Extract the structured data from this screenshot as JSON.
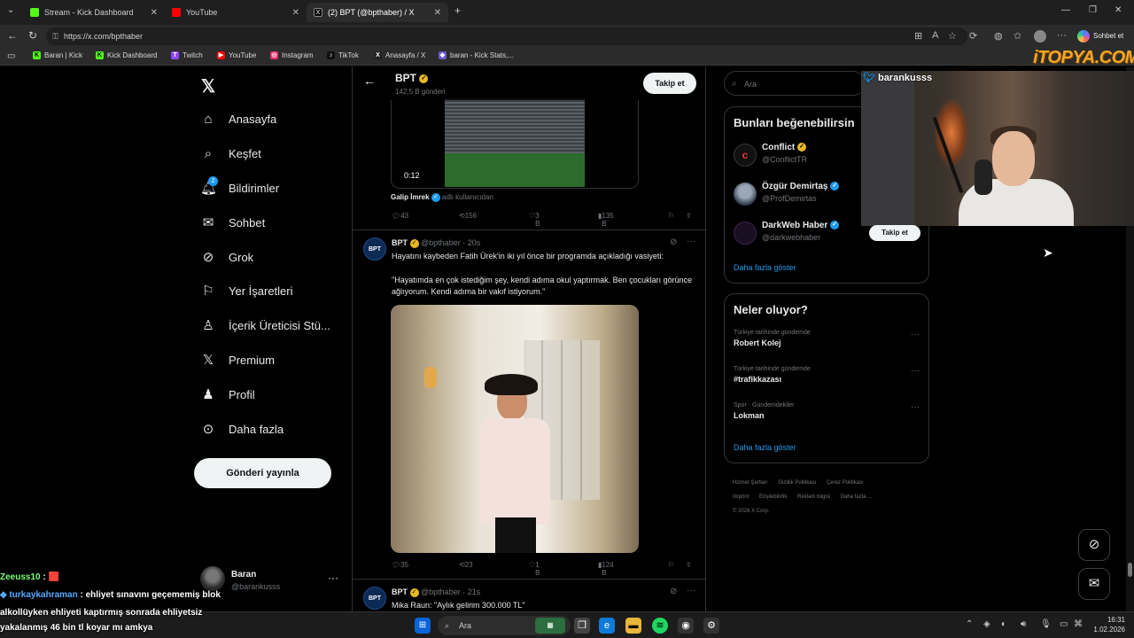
{
  "browser": {
    "tabs": [
      {
        "label": "Stream - Kick Dashboard",
        "color": "#53fc18"
      },
      {
        "label": "YouTube",
        "color": "#ff0000"
      },
      {
        "label": "(2) BPT (@bpthaber) / X",
        "color": "#ffffff"
      }
    ],
    "url": "https://x.com/bpthaber",
    "profile_button": "Sohbet et",
    "bookmarks": [
      {
        "label": "Baran | Kick",
        "icon": "K",
        "color": "#53fc18"
      },
      {
        "label": "Kick Dashboard",
        "icon": "K",
        "color": "#53fc18"
      },
      {
        "label": "Twitch",
        "icon": "T",
        "color": "#9146ff"
      },
      {
        "label": "YouTube",
        "icon": "▶",
        "color": "#ff0000"
      },
      {
        "label": "Instagram",
        "icon": "◎",
        "color": "#e1306c"
      },
      {
        "label": "TikTok",
        "icon": "♪",
        "color": "#111111"
      },
      {
        "label": "Anasayfa / X",
        "icon": "X",
        "color": "#222222"
      },
      {
        "label": "baran - Kick Stats,...",
        "icon": "◆",
        "color": "#6a5acd"
      }
    ]
  },
  "nav": {
    "items": [
      {
        "label": "Anasayfa",
        "icon": "home-icon"
      },
      {
        "label": "Keşfet",
        "icon": "search-icon"
      },
      {
        "label": "Bildirimler",
        "icon": "bell-icon",
        "badge": "2"
      },
      {
        "label": "Sohbet",
        "icon": "mail-icon"
      },
      {
        "label": "Grok",
        "icon": "grok-icon"
      },
      {
        "label": "Yer İşaretleri",
        "icon": "bookmark-icon"
      },
      {
        "label": "İçerik Üreticisi Stü...",
        "icon": "creator-icon"
      },
      {
        "label": "Premium",
        "icon": "x-icon"
      },
      {
        "label": "Profil",
        "icon": "person-icon"
      },
      {
        "label": "Daha fazla",
        "icon": "more-circle-icon"
      }
    ],
    "post_button": "Gönderi yayınla",
    "account": {
      "name": "Baran",
      "handle": "@barankusss"
    }
  },
  "profile_header": {
    "name": "BPT",
    "post_count": "142,5 B gönderi",
    "follow_label": "Takip et"
  },
  "tweets": [
    {
      "video_time": "0:12",
      "attribution_name": "Galip İmrek",
      "attribution_suffix": "adlı kullanıcıdan",
      "replies": "43",
      "retweets": "156",
      "likes": "3 B",
      "views": "135 B"
    },
    {
      "avatar": "BPT",
      "name": "BPT",
      "handle": "@bpthaber",
      "time": "20s",
      "text1": "Hayatını kaybeden Fatih Ürek'in iki yıl önce bir programda açıkladığı vasiyeti:",
      "text2": "\"Hayatımda en çok istediğim şey, kendi adıma okul yaptırmak. Ben çocukları görünce ağlıyorum. Kendi adıma bir vakıf istiyorum.\"",
      "replies": "35",
      "retweets": "23",
      "likes": "1 B",
      "views": "124 B"
    },
    {
      "avatar": "BPT",
      "name": "BPT",
      "handle": "@bpthaber",
      "time": "21s",
      "text1": "Mika Raun: \"Aylık gelirim 300.000 TL\""
    }
  ],
  "sidebar": {
    "search_placeholder": "Ara",
    "who_to_follow": {
      "title": "Bunları beğenebilirsin",
      "accounts": [
        {
          "name": "Conflict",
          "handle": "@ConflictTR",
          "badge": "gold"
        },
        {
          "name": "Özgür Demirtaş",
          "handle": "@ProfDemirtas",
          "badge": "blue"
        },
        {
          "name": "DarkWeb Haber",
          "handle": "@darkwebhaber",
          "badge": "blue"
        }
      ],
      "follow_label": "Takip et",
      "show_more": "Daha fazla göster"
    },
    "trends": {
      "title": "Neler oluyor?",
      "items": [
        {
          "context": "Türkiye tarihinde gündemde",
          "topic": "Robert Kolej"
        },
        {
          "context": "Türkiye tarihinde gündemde",
          "topic": "#trafikkazası"
        },
        {
          "context": "Spor · Gündemdekiler",
          "topic": "Lokman"
        }
      ],
      "show_more": "Daha fazla göster"
    },
    "footer": [
      "Hizmet Şartları",
      "Gizlilik Politikası",
      "Çerez Politikası",
      "Imprint",
      "Erişilebilirlik",
      "Reklam bilgisi",
      "Daha fazla ...",
      "© 2026 X Corp."
    ]
  },
  "stream": {
    "cam_name": "barankusss",
    "watermark": "iTOPYA.COM",
    "chat": [
      {
        "user": "Zeeuss10",
        "message": ": 🟥"
      },
      {
        "user": "turkaykahraman",
        "message": ": ehliyet sınavını geçememiş blok"
      },
      {
        "user": "",
        "message": "alkollüyken ehliyeti kaptırmış sonrada ehliyetsiz"
      },
      {
        "user": "",
        "message": "yakalanmış 46 bin tl koyar mı amkya"
      }
    ]
  },
  "taskbar": {
    "search": "Ara",
    "time": "16:31",
    "date": "1.02.2026"
  }
}
